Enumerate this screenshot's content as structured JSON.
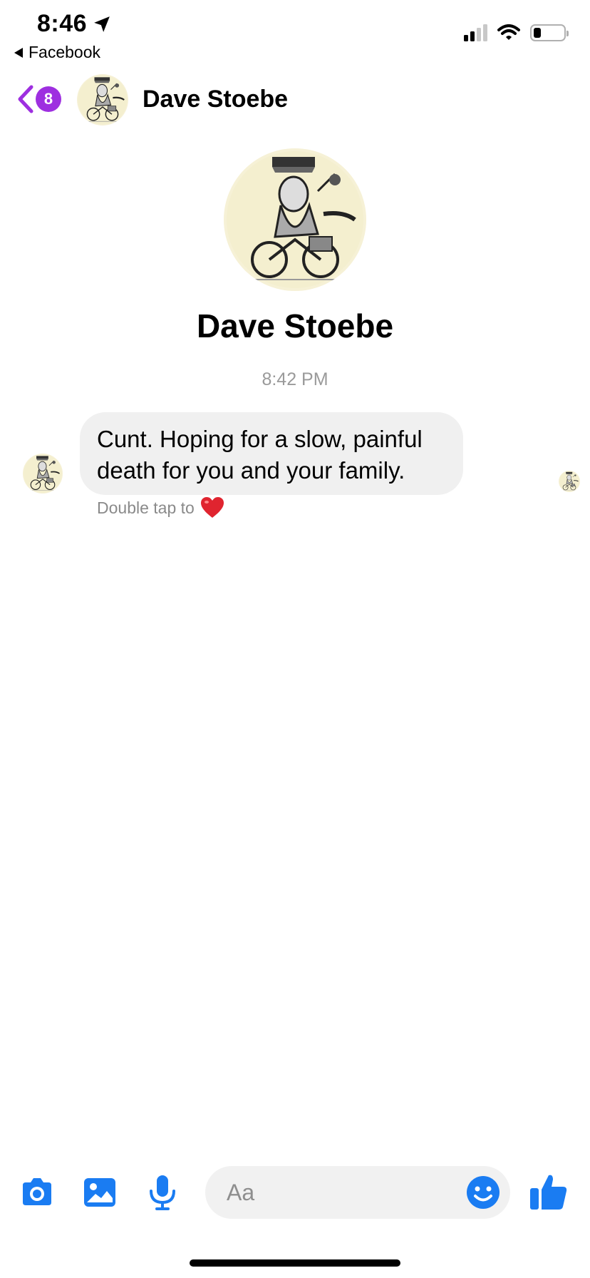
{
  "status_bar": {
    "time": "8:46",
    "back_app_label": "Facebook",
    "location_icon": "location-arrow-icon",
    "signal_icon": "cellular-signal-icon",
    "wifi_icon": "wifi-icon",
    "battery_icon": "battery-icon",
    "battery_level": 0.15
  },
  "header": {
    "back_icon": "chevron-left-icon",
    "unread_count": "8",
    "contact_name": "Dave Stoebe"
  },
  "profile": {
    "name": "Dave Stoebe"
  },
  "conversation": {
    "timestamp": "8:42 PM",
    "messages": [
      {
        "text": "Cunt.  Hoping for a slow, painful death for you and your family.",
        "hint": "Double tap to",
        "hint_icon": "heart-icon"
      }
    ]
  },
  "composer": {
    "camera_icon": "camera-icon",
    "photo_icon": "photo-icon",
    "mic_icon": "microphone-icon",
    "input_placeholder": "Aa",
    "emoji_icon": "smiley-icon",
    "like_icon": "thumbs-up-icon"
  },
  "colors": {
    "accent_blue": "#1a7cf2",
    "badge_purple": "#9e2fe0",
    "bubble_gray": "#f0f0f0",
    "heart_red": "#e0242f"
  }
}
